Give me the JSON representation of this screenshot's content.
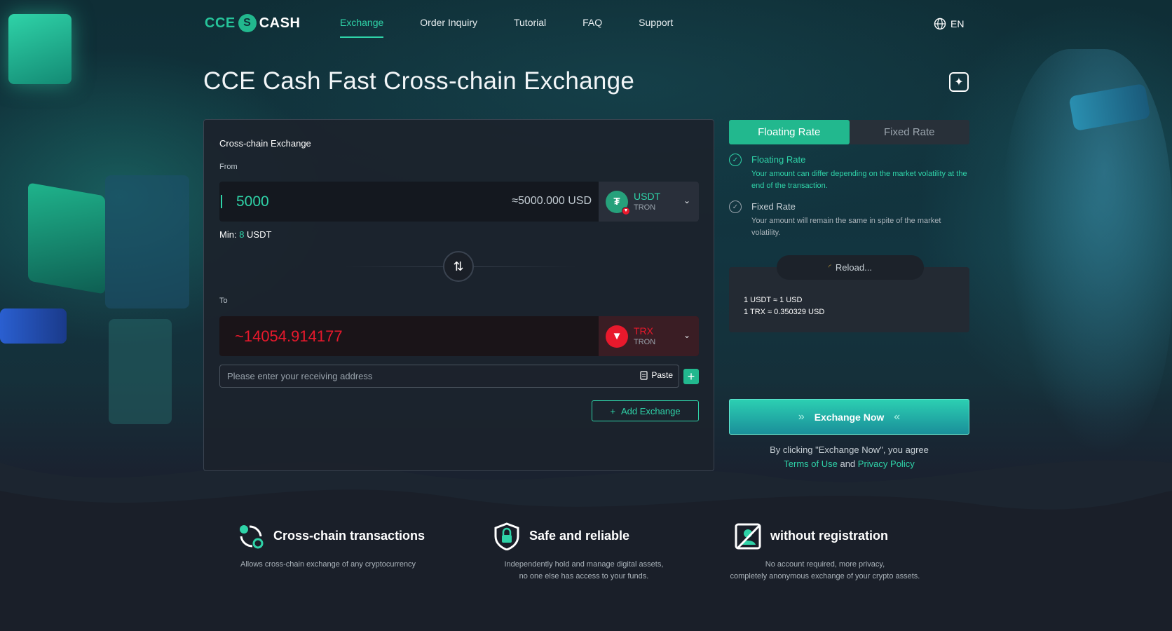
{
  "header": {
    "logo_left": "CCE",
    "logo_right": "CASH",
    "nav": [
      "Exchange",
      "Order Inquiry",
      "Tutorial",
      "FAQ",
      "Support"
    ],
    "lang": "EN"
  },
  "page_title": "CCE Cash Fast Cross-chain Exchange",
  "panel": {
    "title": "Cross-chain Exchange",
    "from_label": "From",
    "from_amount": "5000",
    "from_usd": "≈5000.000 USD",
    "from_coin": {
      "symbol": "USDT",
      "network": "TRON"
    },
    "min_prefix": "Min:",
    "min_value": "8",
    "min_unit": "USDT",
    "to_label": "To",
    "to_amount": "~14054.914177",
    "to_coin": {
      "symbol": "TRX",
      "network": "TRON"
    },
    "address_placeholder": "Please enter your receiving address",
    "paste_label": "Paste",
    "add_exchange_label": "Add Exchange"
  },
  "rate": {
    "tabs": [
      "Floating Rate",
      "Fixed Rate"
    ],
    "floating_title": "Floating Rate",
    "floating_desc": "Your amount can differ depending on the market volatility at the end of the transaction.",
    "fixed_title": "Fixed Rate",
    "fixed_desc": "Your amount will remain the same in spite of the market volatility.",
    "reload_label": "Reload...",
    "rate_line1": "1 USDT ≈ 1 USD",
    "rate_line2": "1 TRX ≈ 0.350329 USD"
  },
  "cta": {
    "exchange_now": "Exchange Now",
    "agree_prefix": "By clicking \"Exchange Now\", you agree",
    "terms": "Terms of Use",
    "and": "and",
    "privacy": "Privacy Policy"
  },
  "features": [
    {
      "title": "Cross-chain transactions",
      "desc1": "Allows cross-chain exchange of any cryptocurrency",
      "desc2": ""
    },
    {
      "title": "Safe and reliable",
      "desc1": "Independently hold and manage digital assets,",
      "desc2": "no one else has access to your funds."
    },
    {
      "title": "without registration",
      "desc1": "No account required, more privacy,",
      "desc2": "completely anonymous exchange of your crypto assets."
    }
  ],
  "colors": {
    "accent": "#2fd3a8",
    "trx_red": "#e8192c",
    "usdt_green": "#26a17b"
  }
}
